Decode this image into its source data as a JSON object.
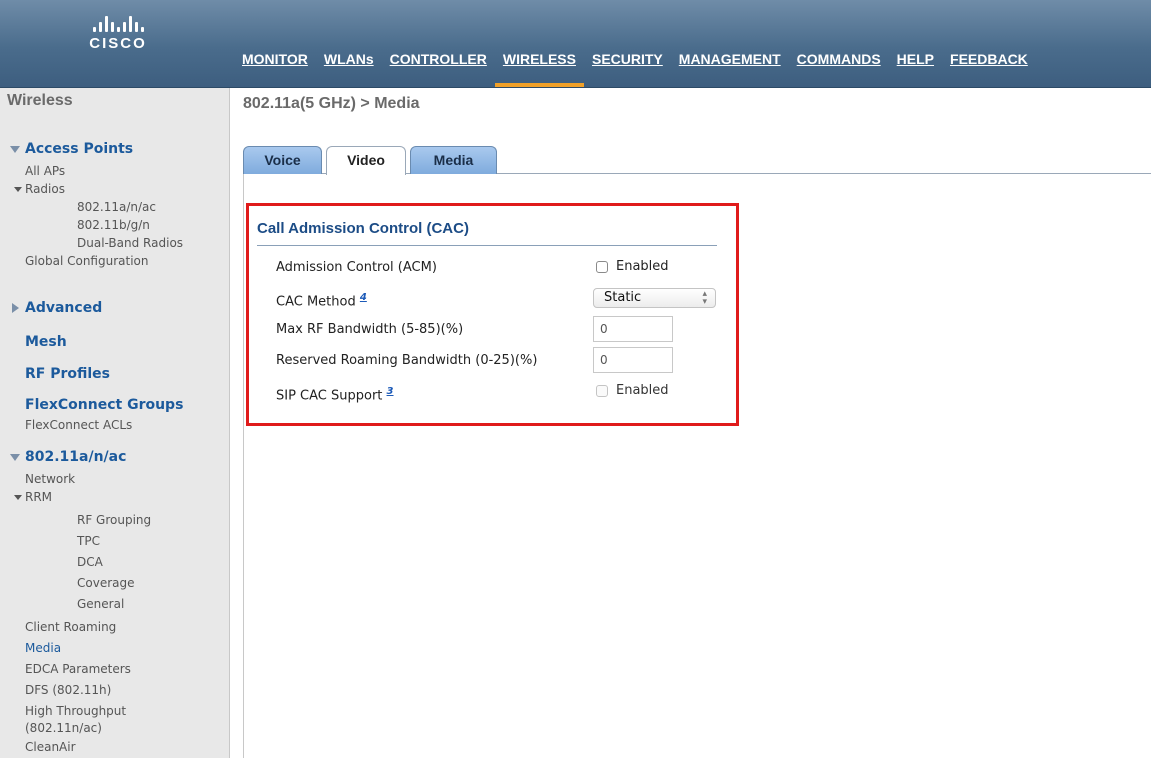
{
  "brand": {
    "logo_text": "CISCO"
  },
  "nav": [
    {
      "label": "MONITOR"
    },
    {
      "label": "WLANs"
    },
    {
      "label": "CONTROLLER"
    },
    {
      "label": "WIRELESS"
    },
    {
      "label": "SECURITY"
    },
    {
      "label": "MANAGEMENT"
    },
    {
      "label": "COMMANDS"
    },
    {
      "label": "HELP"
    },
    {
      "label": "FEEDBACK"
    }
  ],
  "nav_active": "WIRELESS",
  "sidebar": {
    "title": "Wireless",
    "access_points": "Access Points",
    "all_aps": "All APs",
    "radios": "Radios",
    "radio_a": "802.11a/n/ac",
    "radio_b": "802.11b/g/n",
    "dual_band": "Dual-Band Radios",
    "global_config": "Global Configuration",
    "advanced": "Advanced",
    "mesh": "Mesh",
    "rf_profiles": "RF Profiles",
    "flexconnect_groups": "FlexConnect Groups",
    "flexconnect_acls": "FlexConnect ACLs",
    "band_a": "802.11a/n/ac",
    "network": "Network",
    "rrm": "RRM",
    "rf_grouping": "RF Grouping",
    "tpc": "TPC",
    "dca": "DCA",
    "coverage": "Coverage",
    "general": "General",
    "client_roaming": "Client Roaming",
    "media": "Media",
    "edca": "EDCA Parameters",
    "dfs": "DFS (802.11h)",
    "high_throughput_1": "High Throughput",
    "high_throughput_2": "(802.11n/ac)",
    "cleanair": "CleanAir"
  },
  "page": {
    "title": "802.11a(5 GHz) > Media",
    "tabs": [
      "Voice",
      "Video",
      "Media"
    ],
    "active_tab": "Video"
  },
  "cac": {
    "section_title": "Call Admission Control (CAC)",
    "admission_label": "Admission Control (ACM)",
    "admission_cb_label": "Enabled",
    "method_label": "CAC Method",
    "method_footnote": "4",
    "method_value": "Static",
    "max_rf_label": "Max RF Bandwidth (5-85)(%)",
    "max_rf_value": "0",
    "reserved_label": "Reserved Roaming Bandwidth (0-25)(%)",
    "reserved_value": "0",
    "sip_label": "SIP CAC Support",
    "sip_footnote": "3",
    "sip_cb_label": "Enabled"
  },
  "colors": {
    "accent": "#f0a028",
    "highlight_box": "#e01b1b",
    "link": "#1c5a9c",
    "tab_blue": "#8fb6e4"
  }
}
